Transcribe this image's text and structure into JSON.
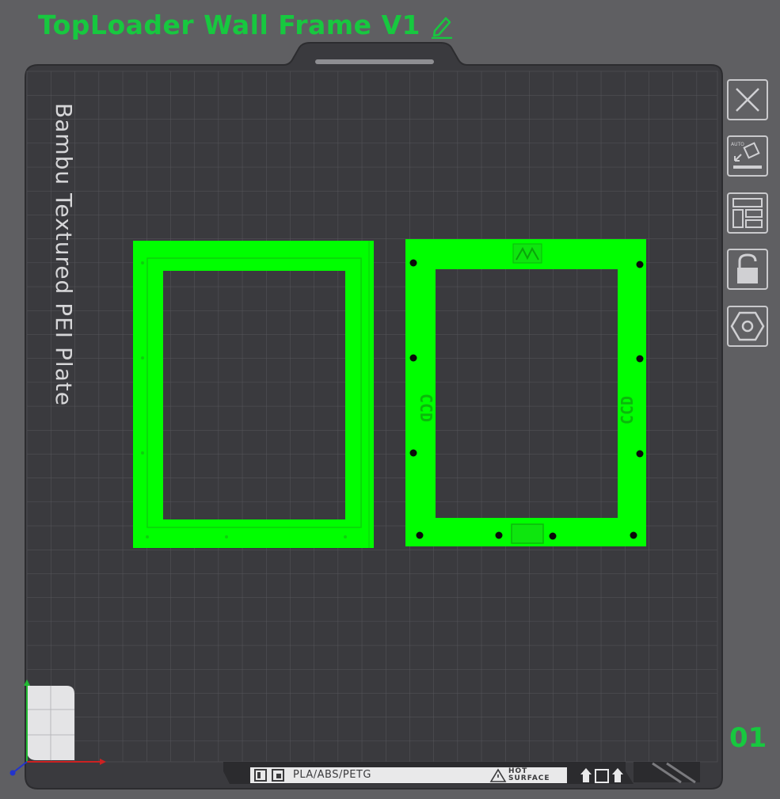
{
  "header": {
    "title": "TopLoader Wall Frame V1"
  },
  "plate": {
    "label": "Bambu Textured PEI Plate",
    "number": "01",
    "filament": "PLA/ABS/PETG",
    "hot_line1": "HOT",
    "hot_line2": "SURFACE"
  },
  "toolbar": {
    "items": [
      "close-icon",
      "auto-orient-icon",
      "arrange-icon",
      "lock-icon",
      "settings-hex-icon"
    ]
  },
  "colors": {
    "accent": "#17c83f",
    "model": "#00ff00",
    "plate_bg": "#3f3f43",
    "grid": "#55555a",
    "page_bg": "#5f5f62"
  }
}
